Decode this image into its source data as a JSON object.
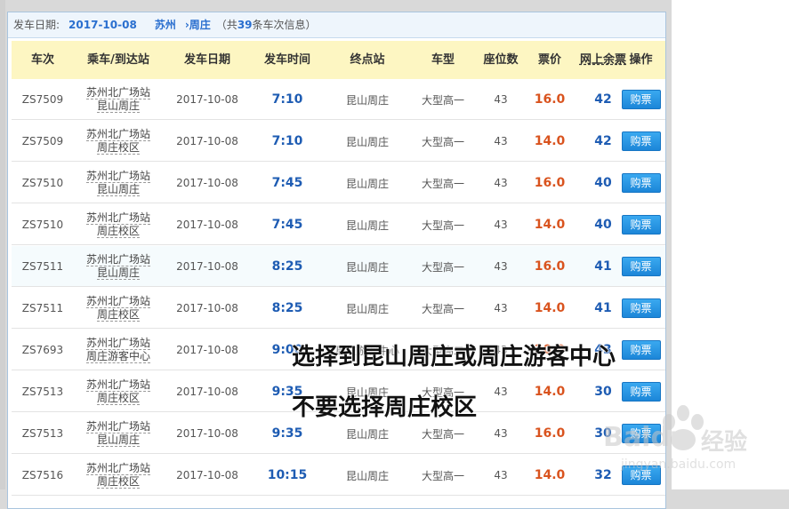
{
  "info_bar": {
    "label": "发车日期:",
    "date": "2017-10-08",
    "from_city": "苏州",
    "arrow": "›",
    "to_city": "周庄",
    "total_prefix": "（共",
    "total_count": "39",
    "total_suffix": "条车次信息）"
  },
  "columns": [
    "车次",
    "乘车/到达站",
    "发车日期",
    "发车时间",
    "终点站",
    "车型",
    "座位数",
    "票价",
    "网上余票",
    "操作"
  ],
  "rows": [
    {
      "train": "ZS7509",
      "from": "苏州北广场站",
      "to": "昆山周庄",
      "date": "2017-10-08",
      "time": "7:10",
      "dest": "昆山周庄",
      "type": "大型高一",
      "seats": "43",
      "price": "16.0",
      "left": "42",
      "action": "购票"
    },
    {
      "train": "ZS7509",
      "from": "苏州北广场站",
      "to": "周庄校区",
      "date": "2017-10-08",
      "time": "7:10",
      "dest": "昆山周庄",
      "type": "大型高一",
      "seats": "43",
      "price": "14.0",
      "left": "42",
      "action": "购票"
    },
    {
      "train": "ZS7510",
      "from": "苏州北广场站",
      "to": "昆山周庄",
      "date": "2017-10-08",
      "time": "7:45",
      "dest": "昆山周庄",
      "type": "大型高一",
      "seats": "43",
      "price": "16.0",
      "left": "40",
      "action": "购票"
    },
    {
      "train": "ZS7510",
      "from": "苏州北广场站",
      "to": "周庄校区",
      "date": "2017-10-08",
      "time": "7:45",
      "dest": "昆山周庄",
      "type": "大型高一",
      "seats": "43",
      "price": "14.0",
      "left": "40",
      "action": "购票"
    },
    {
      "train": "ZS7511",
      "from": "苏州北广场站",
      "to": "昆山周庄",
      "date": "2017-10-08",
      "time": "8:25",
      "dest": "昆山周庄",
      "type": "大型高一",
      "seats": "43",
      "price": "16.0",
      "left": "41",
      "action": "购票"
    },
    {
      "train": "ZS7511",
      "from": "苏州北广场站",
      "to": "周庄校区",
      "date": "2017-10-08",
      "time": "8:25",
      "dest": "昆山周庄",
      "type": "大型高一",
      "seats": "43",
      "price": "14.0",
      "left": "41",
      "action": "购票"
    },
    {
      "train": "ZS7693",
      "from": "苏州北广场站",
      "to": "周庄游客中心",
      "date": "2017-10-08",
      "time": "9:00",
      "dest": "周庄游客中心",
      "type": "大型高二",
      "seats": "43",
      "price": "20.0",
      "left": "43",
      "action": "购票"
    },
    {
      "train": "ZS7513",
      "from": "苏州北广场站",
      "to": "周庄校区",
      "date": "2017-10-08",
      "time": "9:35",
      "dest": "昆山周庄",
      "type": "大型高一",
      "seats": "43",
      "price": "14.0",
      "left": "30",
      "action": "购票"
    },
    {
      "train": "ZS7513",
      "from": "苏州北广场站",
      "to": "昆山周庄",
      "date": "2017-10-08",
      "time": "9:35",
      "dest": "昆山周庄",
      "type": "大型高一",
      "seats": "43",
      "price": "16.0",
      "left": "30",
      "action": "购票"
    },
    {
      "train": "ZS7516",
      "from": "苏州北广场站",
      "to": "周庄校区",
      "date": "2017-10-08",
      "time": "10:15",
      "dest": "昆山周庄",
      "type": "大型高一",
      "seats": "43",
      "price": "14.0",
      "left": "32",
      "action": "购票"
    }
  ],
  "overlay": {
    "line1": "选择到昆山周庄或周庄游客中心",
    "line2": "不要选择周庄校区"
  },
  "watermark": {
    "brand": "Baidu",
    "name": "经验",
    "url": "jingyan.baidu.com"
  }
}
